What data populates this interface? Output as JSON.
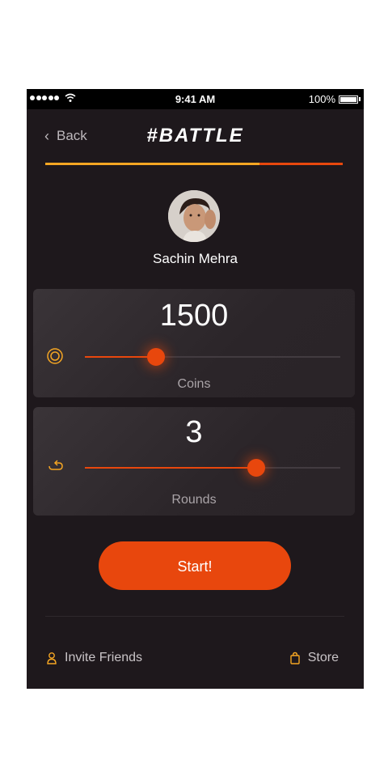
{
  "status_bar": {
    "time": "9:41 AM",
    "battery": "100%",
    "signal_icon": "signal-dots-icon",
    "wifi_icon": "wifi-icon",
    "battery_icon": "battery-icon"
  },
  "header": {
    "back_label": "Back",
    "title": "#BATTLE",
    "progress": 0.72
  },
  "profile": {
    "name": "Sachin Mehra"
  },
  "coins": {
    "value": "1500",
    "label": "Coins",
    "slider_level": 0.28,
    "icon": "coin-icon"
  },
  "rounds": {
    "value": "3",
    "label": "Rounds",
    "slider_level": 0.67,
    "icon": "rounds-icon"
  },
  "start_label": "Start!",
  "footer": {
    "invite_label": "Invite Friends",
    "store_label": "Store",
    "invite_icon": "user-icon",
    "store_icon": "shopping-bag-icon"
  },
  "colors": {
    "accent": "#e8470d",
    "gold": "#f5a623",
    "background": "#1e181c"
  }
}
